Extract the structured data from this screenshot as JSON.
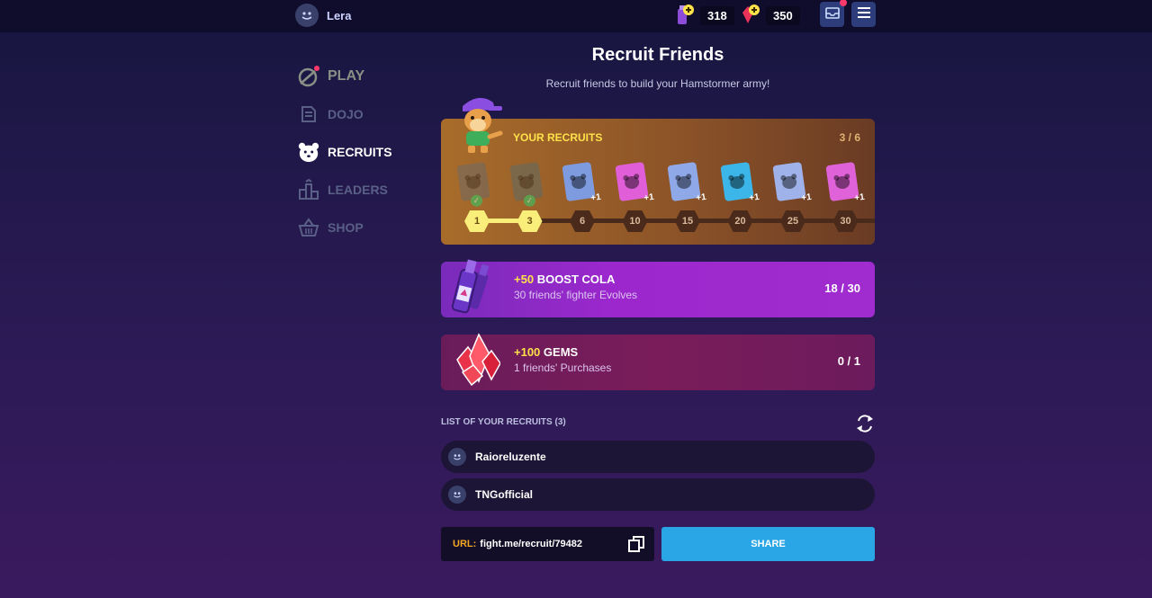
{
  "header": {
    "username": "Lera",
    "currencies": [
      {
        "name": "boost-cola",
        "value": "318",
        "icon": "cola-bottle-icon"
      },
      {
        "name": "gems",
        "value": "350",
        "icon": "gem-icon"
      }
    ],
    "buttons": [
      "inbox-icon",
      "menu-icon"
    ]
  },
  "nav": {
    "items": [
      {
        "label": "PLAY",
        "icon": "play-icon"
      },
      {
        "label": "DOJO",
        "icon": "dojo-icon"
      },
      {
        "label": "RECRUITS",
        "icon": "hamster-icon",
        "active": true
      },
      {
        "label": "LEADERS",
        "icon": "podium-icon"
      },
      {
        "label": "SHOP",
        "icon": "basket-icon"
      }
    ]
  },
  "page": {
    "title": "Recruit Friends",
    "subtitle": "Recruit friends to build your Hamstormer army!"
  },
  "recruits": {
    "label": "YOUR RECRUITS",
    "count": "3 / 6",
    "cards": [
      {
        "color": "#6e6a66",
        "claimed": true,
        "plus": ""
      },
      {
        "color": "#5e6a64",
        "claimed": true,
        "plus": ""
      },
      {
        "color": "#7e9be0",
        "claimed": false,
        "plus": "+1"
      },
      {
        "color": "#e05fd8",
        "claimed": false,
        "plus": "+1"
      },
      {
        "color": "#8fa9e8",
        "claimed": false,
        "plus": "+1"
      },
      {
        "color": "#3cb6e8",
        "claimed": false,
        "plus": "+1"
      },
      {
        "color": "#9fb3ea",
        "claimed": false,
        "plus": "+1"
      },
      {
        "color": "#e062d8",
        "claimed": false,
        "plus": "+1"
      }
    ],
    "milestones": [
      {
        "label": "1",
        "done": true
      },
      {
        "label": "3",
        "done": true
      },
      {
        "label": "6",
        "done": false
      },
      {
        "label": "10",
        "done": false
      },
      {
        "label": "15",
        "done": false
      },
      {
        "label": "20",
        "done": false
      },
      {
        "label": "25",
        "done": false
      },
      {
        "label": "30",
        "done": false
      }
    ]
  },
  "rewards": [
    {
      "amount": "+50",
      "title": "BOOST COLA",
      "desc": "30 friends' fighter Evolves",
      "progress": "18 / 30"
    },
    {
      "amount": "+100",
      "title": "GEMS",
      "desc": "1 friends' Purchases",
      "progress": "0 / 1"
    }
  ],
  "list": {
    "header": "LIST OF YOUR RECRUITS (3)",
    "friends": [
      "Raioreluzente",
      "TNGofficial"
    ]
  },
  "share": {
    "url_label": "URL:",
    "url": "fight.me/recruit/79482",
    "button": "SHARE"
  },
  "colors": {
    "accent_blue": "#2aa6e6",
    "highlight_yellow": "#ffe24a",
    "url_label": "#f5a623"
  }
}
